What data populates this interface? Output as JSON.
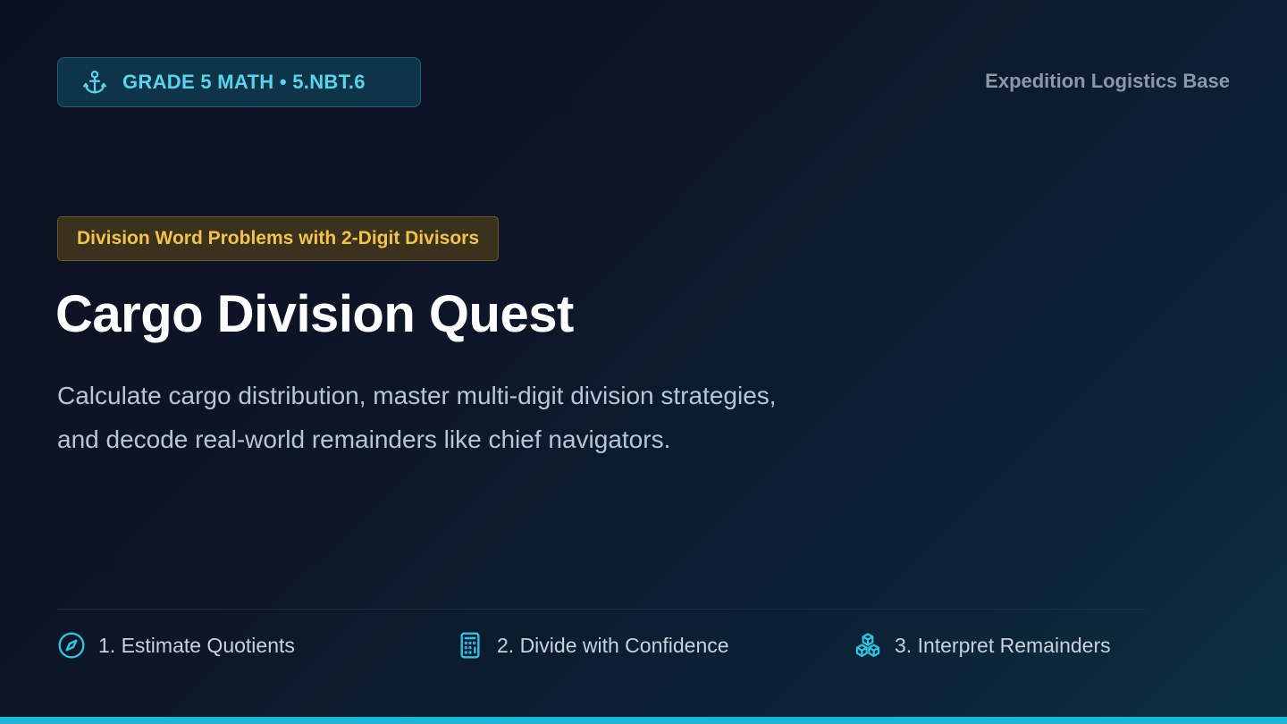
{
  "badge": {
    "icon": "anchor-icon",
    "label": "GRADE 5 MATH • 5.NBT.6",
    "accent_color": "#5ad4ee"
  },
  "header": {
    "base_label": "Expedition Logistics Base"
  },
  "topic_tag": "Division Word Problems with 2-Digit Divisors",
  "title": "Cargo Division Quest",
  "subtitle": "Calculate cargo distribution, master multi-digit division strategies, and decode real-world remainders like chief navigators.",
  "steps": [
    {
      "label": "1. Estimate Quotients",
      "icon": "compass-icon"
    },
    {
      "label": "2. Divide with Confidence",
      "icon": "calculator-icon"
    },
    {
      "label": "3. Interpret Remainders",
      "icon": "boxes-icon"
    }
  ],
  "colors": {
    "accent": "#16b8d8",
    "tag_text": "#f2c34a"
  }
}
